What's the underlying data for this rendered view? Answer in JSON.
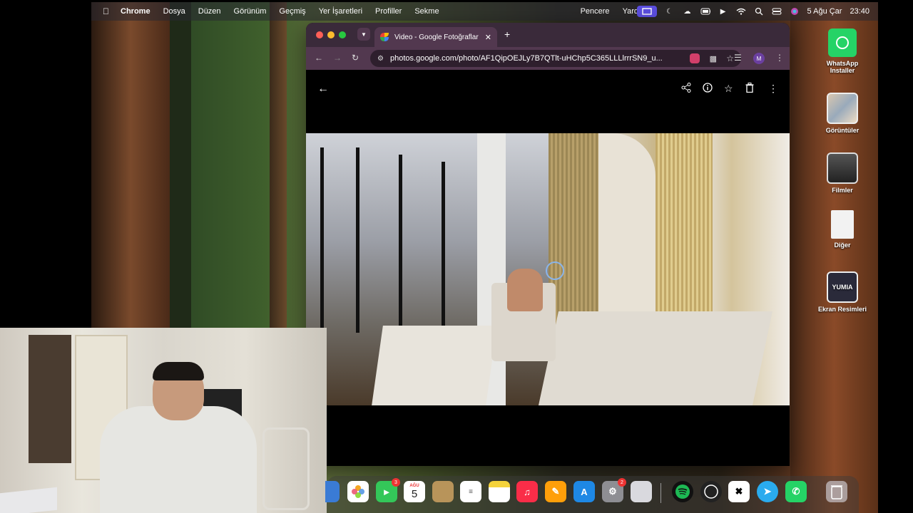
{
  "menubar": {
    "app": "Chrome",
    "items": [
      "Dosya",
      "Düzen",
      "Görünüm",
      "Geçmiş",
      "Yer İşaretleri",
      "Profiller",
      "Sekme",
      "Pencere",
      "Yardım"
    ],
    "date": "5 Ağu Çar",
    "time": "23:40"
  },
  "browser": {
    "tab_title": "Video - Google Fotoğraflar",
    "url": "photos.google.com/photo/AF1QipOEJLy7B7QTlt-uHChp5C365LLLlrrrSN9_u...",
    "profile_initial": "M"
  },
  "desktop": {
    "items": [
      {
        "label": "WhatsApp Installer"
      },
      {
        "label": "Görüntüler"
      },
      {
        "label": "Filmler"
      },
      {
        "label": "Diğer"
      },
      {
        "label": "Ekran Resimleri"
      }
    ],
    "yumia_text": "YUMIA"
  },
  "dock": {
    "facetime_badge": "3",
    "calendar_month": "AĞU",
    "calendar_day": "5",
    "settings_badge": "2"
  },
  "colors": {
    "screen_record_accent": "#5b4ee0",
    "tab_bg": "#52384f",
    "whatsapp": "#25d366"
  }
}
